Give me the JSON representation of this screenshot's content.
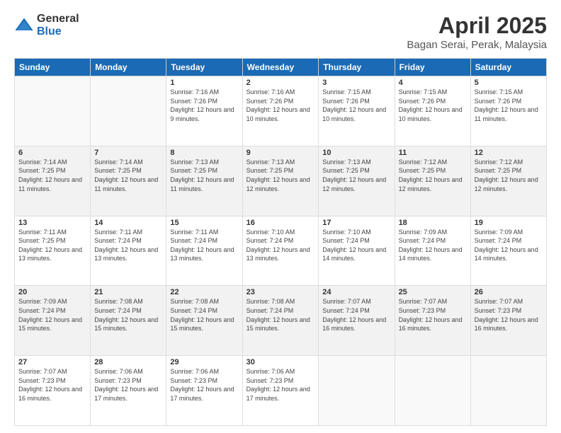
{
  "logo": {
    "general": "General",
    "blue": "Blue"
  },
  "title": "April 2025",
  "subtitle": "Bagan Serai, Perak, Malaysia",
  "days_of_week": [
    "Sunday",
    "Monday",
    "Tuesday",
    "Wednesday",
    "Thursday",
    "Friday",
    "Saturday"
  ],
  "weeks": [
    [
      {
        "day": "",
        "sunrise": "",
        "sunset": "",
        "daylight": ""
      },
      {
        "day": "",
        "sunrise": "",
        "sunset": "",
        "daylight": ""
      },
      {
        "day": "1",
        "sunrise": "Sunrise: 7:16 AM",
        "sunset": "Sunset: 7:26 PM",
        "daylight": "Daylight: 12 hours and 9 minutes."
      },
      {
        "day": "2",
        "sunrise": "Sunrise: 7:16 AM",
        "sunset": "Sunset: 7:26 PM",
        "daylight": "Daylight: 12 hours and 10 minutes."
      },
      {
        "day": "3",
        "sunrise": "Sunrise: 7:15 AM",
        "sunset": "Sunset: 7:26 PM",
        "daylight": "Daylight: 12 hours and 10 minutes."
      },
      {
        "day": "4",
        "sunrise": "Sunrise: 7:15 AM",
        "sunset": "Sunset: 7:26 PM",
        "daylight": "Daylight: 12 hours and 10 minutes."
      },
      {
        "day": "5",
        "sunrise": "Sunrise: 7:15 AM",
        "sunset": "Sunset: 7:26 PM",
        "daylight": "Daylight: 12 hours and 11 minutes."
      }
    ],
    [
      {
        "day": "6",
        "sunrise": "Sunrise: 7:14 AM",
        "sunset": "Sunset: 7:25 PM",
        "daylight": "Daylight: 12 hours and 11 minutes."
      },
      {
        "day": "7",
        "sunrise": "Sunrise: 7:14 AM",
        "sunset": "Sunset: 7:25 PM",
        "daylight": "Daylight: 12 hours and 11 minutes."
      },
      {
        "day": "8",
        "sunrise": "Sunrise: 7:13 AM",
        "sunset": "Sunset: 7:25 PM",
        "daylight": "Daylight: 12 hours and 11 minutes."
      },
      {
        "day": "9",
        "sunrise": "Sunrise: 7:13 AM",
        "sunset": "Sunset: 7:25 PM",
        "daylight": "Daylight: 12 hours and 12 minutes."
      },
      {
        "day": "10",
        "sunrise": "Sunrise: 7:13 AM",
        "sunset": "Sunset: 7:25 PM",
        "daylight": "Daylight: 12 hours and 12 minutes."
      },
      {
        "day": "11",
        "sunrise": "Sunrise: 7:12 AM",
        "sunset": "Sunset: 7:25 PM",
        "daylight": "Daylight: 12 hours and 12 minutes."
      },
      {
        "day": "12",
        "sunrise": "Sunrise: 7:12 AM",
        "sunset": "Sunset: 7:25 PM",
        "daylight": "Daylight: 12 hours and 12 minutes."
      }
    ],
    [
      {
        "day": "13",
        "sunrise": "Sunrise: 7:11 AM",
        "sunset": "Sunset: 7:25 PM",
        "daylight": "Daylight: 12 hours and 13 minutes."
      },
      {
        "day": "14",
        "sunrise": "Sunrise: 7:11 AM",
        "sunset": "Sunset: 7:24 PM",
        "daylight": "Daylight: 12 hours and 13 minutes."
      },
      {
        "day": "15",
        "sunrise": "Sunrise: 7:11 AM",
        "sunset": "Sunset: 7:24 PM",
        "daylight": "Daylight: 12 hours and 13 minutes."
      },
      {
        "day": "16",
        "sunrise": "Sunrise: 7:10 AM",
        "sunset": "Sunset: 7:24 PM",
        "daylight": "Daylight: 12 hours and 13 minutes."
      },
      {
        "day": "17",
        "sunrise": "Sunrise: 7:10 AM",
        "sunset": "Sunset: 7:24 PM",
        "daylight": "Daylight: 12 hours and 14 minutes."
      },
      {
        "day": "18",
        "sunrise": "Sunrise: 7:09 AM",
        "sunset": "Sunset: 7:24 PM",
        "daylight": "Daylight: 12 hours and 14 minutes."
      },
      {
        "day": "19",
        "sunrise": "Sunrise: 7:09 AM",
        "sunset": "Sunset: 7:24 PM",
        "daylight": "Daylight: 12 hours and 14 minutes."
      }
    ],
    [
      {
        "day": "20",
        "sunrise": "Sunrise: 7:09 AM",
        "sunset": "Sunset: 7:24 PM",
        "daylight": "Daylight: 12 hours and 15 minutes."
      },
      {
        "day": "21",
        "sunrise": "Sunrise: 7:08 AM",
        "sunset": "Sunset: 7:24 PM",
        "daylight": "Daylight: 12 hours and 15 minutes."
      },
      {
        "day": "22",
        "sunrise": "Sunrise: 7:08 AM",
        "sunset": "Sunset: 7:24 PM",
        "daylight": "Daylight: 12 hours and 15 minutes."
      },
      {
        "day": "23",
        "sunrise": "Sunrise: 7:08 AM",
        "sunset": "Sunset: 7:24 PM",
        "daylight": "Daylight: 12 hours and 15 minutes."
      },
      {
        "day": "24",
        "sunrise": "Sunrise: 7:07 AM",
        "sunset": "Sunset: 7:24 PM",
        "daylight": "Daylight: 12 hours and 16 minutes."
      },
      {
        "day": "25",
        "sunrise": "Sunrise: 7:07 AM",
        "sunset": "Sunset: 7:23 PM",
        "daylight": "Daylight: 12 hours and 16 minutes."
      },
      {
        "day": "26",
        "sunrise": "Sunrise: 7:07 AM",
        "sunset": "Sunset: 7:23 PM",
        "daylight": "Daylight: 12 hours and 16 minutes."
      }
    ],
    [
      {
        "day": "27",
        "sunrise": "Sunrise: 7:07 AM",
        "sunset": "Sunset: 7:23 PM",
        "daylight": "Daylight: 12 hours and 16 minutes."
      },
      {
        "day": "28",
        "sunrise": "Sunrise: 7:06 AM",
        "sunset": "Sunset: 7:23 PM",
        "daylight": "Daylight: 12 hours and 17 minutes."
      },
      {
        "day": "29",
        "sunrise": "Sunrise: 7:06 AM",
        "sunset": "Sunset: 7:23 PM",
        "daylight": "Daylight: 12 hours and 17 minutes."
      },
      {
        "day": "30",
        "sunrise": "Sunrise: 7:06 AM",
        "sunset": "Sunset: 7:23 PM",
        "daylight": "Daylight: 12 hours and 17 minutes."
      },
      {
        "day": "",
        "sunrise": "",
        "sunset": "",
        "daylight": ""
      },
      {
        "day": "",
        "sunrise": "",
        "sunset": "",
        "daylight": ""
      },
      {
        "day": "",
        "sunrise": "",
        "sunset": "",
        "daylight": ""
      }
    ]
  ]
}
